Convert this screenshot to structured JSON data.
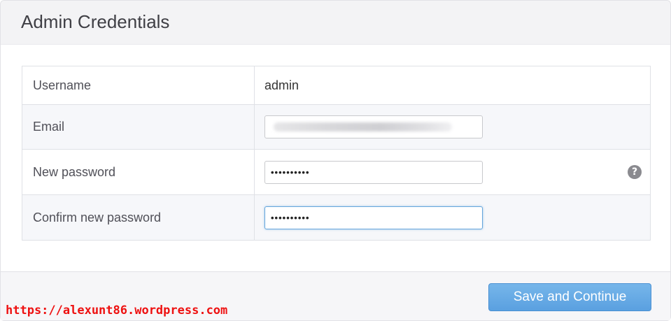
{
  "panel": {
    "title": "Admin Credentials"
  },
  "form": {
    "rows": [
      {
        "label": "Username",
        "value": "admin"
      },
      {
        "label": "Email",
        "value": ""
      },
      {
        "label": "New password",
        "value": "••••••••••"
      },
      {
        "label": "Confirm new password",
        "value": "••••••••••"
      }
    ],
    "help_icon_glyph": "?"
  },
  "footer": {
    "save_label": "Save and Continue"
  },
  "watermark": {
    "text": "https://alexunt86.wordpress.com"
  },
  "colors": {
    "accent": "#5aa0e0",
    "watermark": "#ee1111"
  },
  "icons": [
    "help-icon"
  ]
}
